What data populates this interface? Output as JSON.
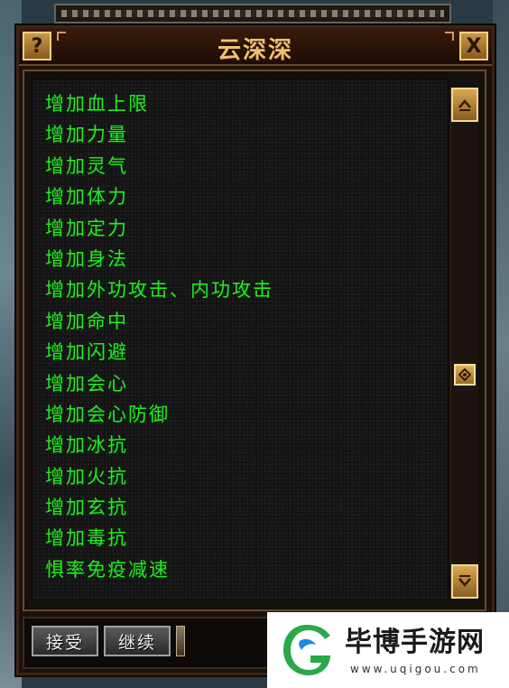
{
  "window": {
    "title": "云深深",
    "help_label": "?",
    "close_label": "X"
  },
  "list": {
    "items": [
      "增加血上限",
      "增加力量",
      "增加灵气",
      "增加体力",
      "增加定力",
      "增加身法",
      "增加外功攻击、内功攻击",
      "增加命中",
      "增加闪避",
      "增加会心",
      "增加会心防御",
      "增加冰抗",
      "增加火抗",
      "增加玄抗",
      "增加毒抗",
      "惧率免疫减速"
    ]
  },
  "scrollbar": {
    "up_icon": "chevron-up-icon",
    "down_icon": "chevron-down-icon",
    "position": 0.55
  },
  "actions": {
    "accept_label": "接受",
    "continue_label": "继续"
  },
  "watermark": {
    "title": "毕博手游网",
    "url": "www.uqigou.com"
  },
  "colors": {
    "list_text": "#28e828",
    "title_text": "#f0c070",
    "button_gold": "#d8a850"
  }
}
